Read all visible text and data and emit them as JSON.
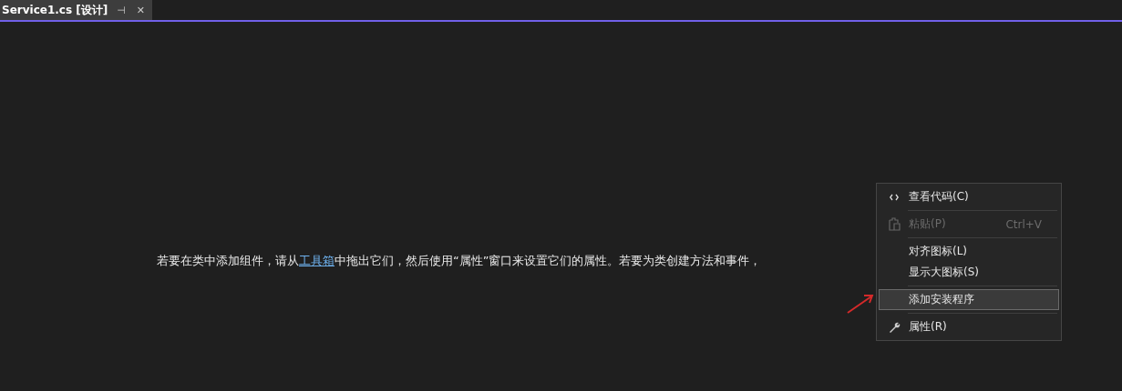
{
  "tab": {
    "title": "Service1.cs [设计]",
    "pin_glyph": "⊣",
    "close_glyph": "✕",
    "selected": true
  },
  "canvas": {
    "hint_before": "若要在类中添加组件，请从",
    "hint_link": "工具箱",
    "hint_after": "中拖出它们，然后使用“属性”窗口来设置它们的属性。若要为类创建方法和事件，"
  },
  "context_menu": {
    "items": [
      {
        "kind": "item",
        "label": "查看代码(C)",
        "disabled": false,
        "selected": false
      },
      {
        "kind": "separator"
      },
      {
        "kind": "item",
        "label": "粘贴(P)",
        "shortcut": "Ctrl+V",
        "disabled": true,
        "selected": false
      },
      {
        "kind": "separator"
      },
      {
        "kind": "item",
        "label": "对齐图标(L)",
        "disabled": false,
        "selected": false
      },
      {
        "kind": "item",
        "label": "显示大图标(S)",
        "disabled": false,
        "selected": false
      },
      {
        "kind": "separator"
      },
      {
        "kind": "item",
        "label": "添加安装程序",
        "disabled": false,
        "selected": true
      },
      {
        "kind": "separator"
      },
      {
        "kind": "item",
        "label": "属性(R)",
        "disabled": false,
        "selected": false
      }
    ]
  }
}
